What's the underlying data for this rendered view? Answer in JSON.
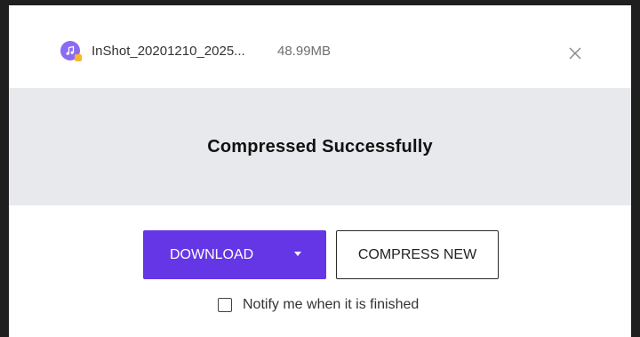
{
  "file": {
    "name": "InShot_20201210_2025...",
    "size": "48.99MB",
    "icon": "music-file-icon"
  },
  "status": {
    "message": "Compressed Successfully"
  },
  "actions": {
    "download_label": "DOWNLOAD",
    "compress_new_label": "COMPRESS NEW",
    "accent_color": "#6536e6"
  },
  "notify": {
    "label": "Notify me when it is finished",
    "checked": false
  }
}
